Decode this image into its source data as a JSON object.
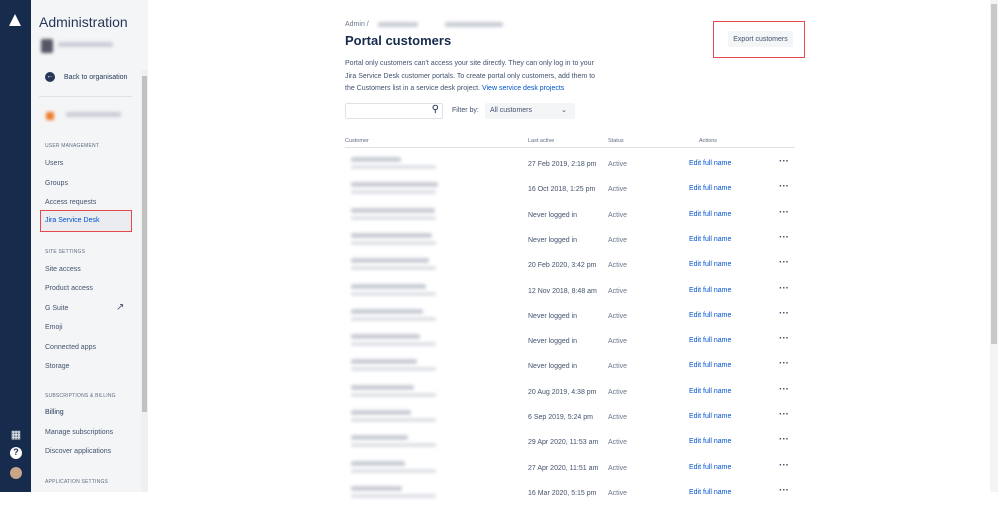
{
  "sidebar": {
    "title": "Administration",
    "back": "Back to organisation",
    "sections": [
      {
        "heading": "USER MANAGEMENT",
        "items": [
          "Users",
          "Groups",
          "Access requests",
          "Jira Service Desk"
        ]
      },
      {
        "heading": "SITE SETTINGS",
        "items": [
          "Site access",
          "Product access",
          "G Suite",
          "Emoji",
          "Connected apps",
          "Storage"
        ]
      },
      {
        "heading": "SUBSCRIPTIONS & BILLING",
        "items": [
          "Billing",
          "Manage subscriptions",
          "Discover applications"
        ]
      },
      {
        "heading": "APPLICATION SETTINGS",
        "items": []
      }
    ],
    "selected": "Jira Service Desk"
  },
  "main": {
    "breadcrumb_root": "Admin",
    "breadcrumb_sep": "/",
    "title": "Portal customers",
    "description": "Portal only customers can't access your site directly. They can only log in to your Jira Service Desk customer portals. To create portal only customers, add them to the Customers list in a service desk project.",
    "link": "View service desk projects",
    "export": "Export customers",
    "filter_label": "Filter by:",
    "filter_value": "All customers",
    "columns": [
      "Customer",
      "Last active",
      "Status",
      "Actions"
    ],
    "action_label": "Edit full name",
    "rows": [
      {
        "last": "27 Feb 2019, 2:18 pm",
        "status": "Active"
      },
      {
        "last": "16 Oct 2018, 1:25 pm",
        "status": "Active"
      },
      {
        "last": "Never logged in",
        "status": "Active"
      },
      {
        "last": "Never logged in",
        "status": "Active"
      },
      {
        "last": "20 Feb 2020, 3:42 pm",
        "status": "Active"
      },
      {
        "last": "12 Nov 2018, 8:48 am",
        "status": "Active"
      },
      {
        "last": "Never logged in",
        "status": "Active"
      },
      {
        "last": "Never logged in",
        "status": "Active"
      },
      {
        "last": "Never logged in",
        "status": "Active"
      },
      {
        "last": "20 Aug 2019, 4:38 pm",
        "status": "Active"
      },
      {
        "last": "6 Sep 2019, 5:24 pm",
        "status": "Active"
      },
      {
        "last": "29 Apr 2020, 11:53 am",
        "status": "Active"
      },
      {
        "last": "27 Apr 2020, 11:51 am",
        "status": "Active"
      },
      {
        "last": "16 Mar 2020, 5:15 pm",
        "status": "Active"
      }
    ]
  }
}
